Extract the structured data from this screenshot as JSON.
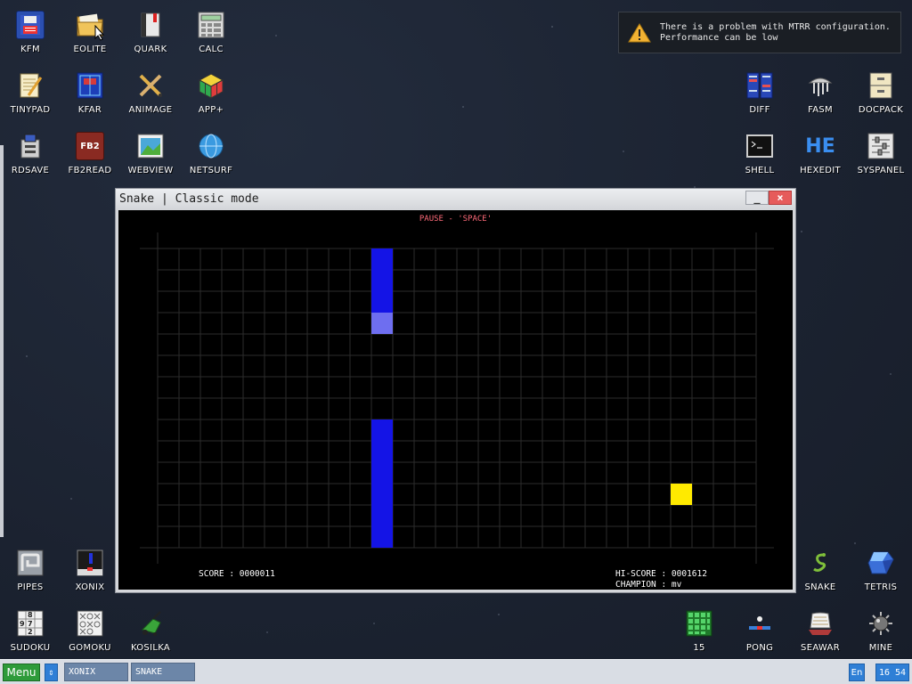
{
  "notification": {
    "line1": "There is a problem with MTRR configuration.",
    "line2": "Performance can be low"
  },
  "desktop_icons": [
    {
      "label": "KFM",
      "icon": "floppy-disk-icon"
    },
    {
      "label": "EOLITE",
      "icon": "folder-icon"
    },
    {
      "label": "QUARK",
      "icon": "book-icon"
    },
    {
      "label": "CALC",
      "icon": "calculator-icon"
    },
    {
      "label": "TINYPAD",
      "icon": "notepad-icon"
    },
    {
      "label": "KFAR",
      "icon": "kfar-icon"
    },
    {
      "label": "ANIMAGE",
      "icon": "paint-tools-icon"
    },
    {
      "label": "APP+",
      "icon": "rubiks-cube-icon"
    },
    {
      "label": "RDSAVE",
      "icon": "rdsave-icon"
    },
    {
      "label": "FB2READ",
      "icon": "fb2-book-icon"
    },
    {
      "label": "WEBVIEW",
      "icon": "web-page-icon"
    },
    {
      "label": "NETSURF",
      "icon": "globe-icon"
    },
    {
      "label": "DIFF",
      "icon": "diff-icon"
    },
    {
      "label": "FASM",
      "icon": "fasm-icon"
    },
    {
      "label": "DOCPACK",
      "icon": "cabinet-icon"
    },
    {
      "label": "SHELL",
      "icon": "terminal-icon"
    },
    {
      "label": "HEXEDIT",
      "icon": "hex-icon"
    },
    {
      "label": "SYSPANEL",
      "icon": "sliders-icon"
    },
    {
      "label": "PIPES",
      "icon": "pipes-icon"
    },
    {
      "label": "XONIX",
      "icon": "xonix-icon"
    },
    {
      "label": "SUDOKU",
      "icon": "sudoku-icon"
    },
    {
      "label": "GOMOKU",
      "icon": "gomoku-icon"
    },
    {
      "label": "KOSILKA",
      "icon": "lawnmower-icon"
    },
    {
      "label": "SNAKE",
      "icon": "snake-icon"
    },
    {
      "label": "TETRIS",
      "icon": "tetris-block-icon"
    },
    {
      "label": "15",
      "icon": "fifteen-puzzle-icon"
    },
    {
      "label": "PONG",
      "icon": "pong-icon"
    },
    {
      "label": "SEAWAR",
      "icon": "ship-icon"
    },
    {
      "label": "MINE",
      "icon": "mine-icon"
    }
  ],
  "window": {
    "title": "Snake | Classic mode",
    "minimize": "_",
    "close": "×"
  },
  "game": {
    "pause_text": "PAUSE - 'SPACE'",
    "score_line": "SCORE : 0000011",
    "hiscore_line": "HI-SCORE : 0001612",
    "champion_line": "CHAMPION : mv",
    "grid_cols": 28,
    "grid_rows": 14,
    "snake_cells": [
      [
        10,
        0
      ],
      [
        10,
        1
      ],
      [
        10,
        2
      ],
      [
        10,
        8
      ],
      [
        10,
        9
      ],
      [
        10,
        10
      ],
      [
        10,
        11
      ],
      [
        10,
        12
      ],
      [
        10,
        13
      ]
    ],
    "snake_head": [
      10,
      3
    ],
    "food": [
      24,
      11
    ],
    "colors": {
      "snake": "#1414e6",
      "head": "#6e6ef0",
      "food": "#ffea00",
      "grid": "#2c2c2c",
      "pause": "#ff6b7a"
    }
  },
  "taskbar": {
    "menu": "Menu",
    "switch": "⇕",
    "tasks": [
      "XONIX",
      "SNAKE"
    ],
    "lang": "En",
    "clock": "16 54"
  }
}
